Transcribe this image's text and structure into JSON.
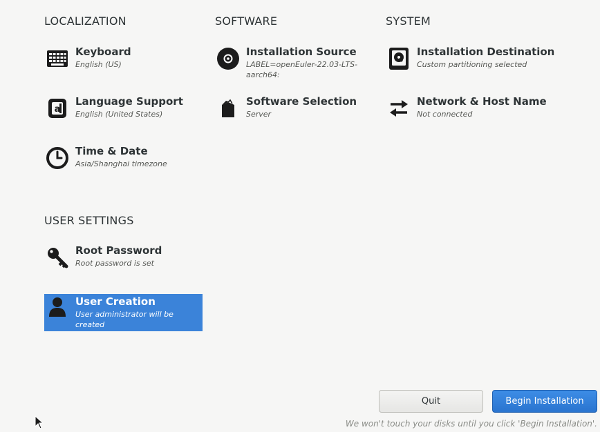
{
  "sections": {
    "localization": "LOCALIZATION",
    "software": "SOFTWARE",
    "system": "SYSTEM",
    "user_settings": "USER SETTINGS"
  },
  "spokes": {
    "keyboard": {
      "title": "Keyboard",
      "status": "English (US)",
      "icon": "keyboard-icon"
    },
    "language": {
      "title": "Language Support",
      "status": "English (United States)",
      "icon": "language-icon"
    },
    "time": {
      "title": "Time & Date",
      "status": "Asia/Shanghai timezone",
      "icon": "clock-icon"
    },
    "source": {
      "title": "Installation Source",
      "status": "LABEL=openEuler-22.03-LTS-aarch64:",
      "icon": "disc-icon"
    },
    "software": {
      "title": "Software Selection",
      "status": "Server",
      "icon": "package-icon"
    },
    "destination": {
      "title": "Installation Destination",
      "status": "Custom partitioning selected",
      "icon": "disk-icon"
    },
    "network": {
      "title": "Network & Host Name",
      "status": "Not connected",
      "icon": "network-arrows-icon"
    },
    "root": {
      "title": "Root Password",
      "status": "Root password is set",
      "icon": "key-icon"
    },
    "user": {
      "title": "User Creation",
      "status": "User administrator will be created",
      "icon": "user-icon",
      "selected": true
    }
  },
  "buttons": {
    "quit": "Quit",
    "begin": "Begin Installation"
  },
  "footer_note": "We won't touch your disks until you click 'Begin Installation'.",
  "colors": {
    "accent": "#3b83d9",
    "background": "#f6f6f5",
    "text": "#2e3436"
  }
}
